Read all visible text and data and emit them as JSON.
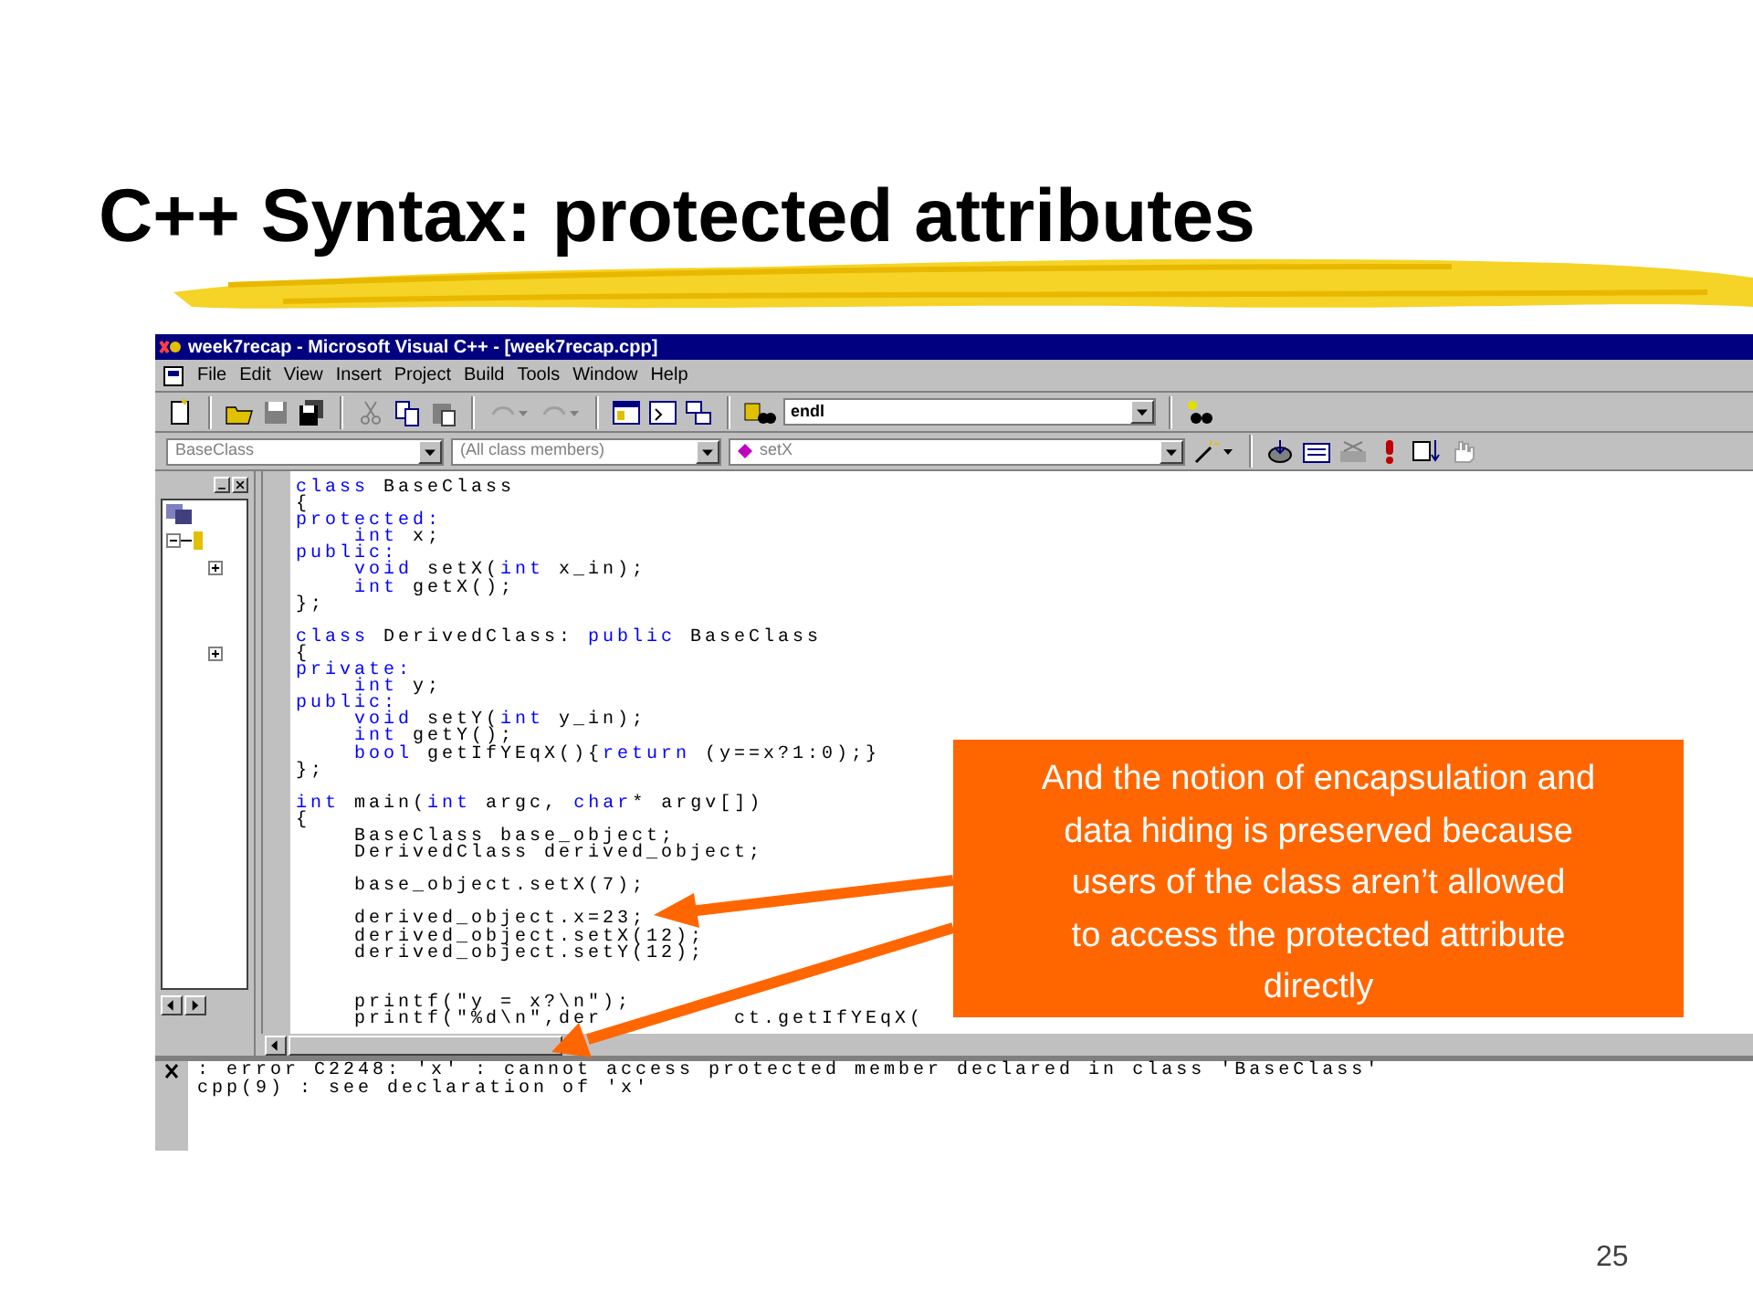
{
  "slide": {
    "title": "C++ Syntax: protected attributes",
    "page_number": "25"
  },
  "window": {
    "title": "week7recap - Microsoft Visual C++ - [week7recap.cpp]"
  },
  "menu": [
    "File",
    "Edit",
    "View",
    "Insert",
    "Project",
    "Build",
    "Tools",
    "Window",
    "Help"
  ],
  "toolbar": {
    "find_value": "endl"
  },
  "wizard_bar": {
    "class": "BaseClass",
    "filter": "(All class members)",
    "member": "setX"
  },
  "editor": {
    "lines": [
      {
        "kind": "code",
        "segments": [
          {
            "kind": "keyword",
            "text": "class"
          },
          {
            "kind": "plain",
            "text": " BaseClass"
          }
        ]
      },
      {
        "kind": "code",
        "segments": [
          {
            "kind": "plain",
            "text": "{"
          }
        ]
      },
      {
        "kind": "code",
        "segments": [
          {
            "kind": "keyword",
            "text": "protected:"
          }
        ]
      },
      {
        "kind": "code",
        "segments": [
          {
            "kind": "keyword",
            "text": "    int"
          },
          {
            "kind": "plain",
            "text": " x;"
          }
        ]
      },
      {
        "kind": "code",
        "segments": [
          {
            "kind": "keyword",
            "text": "public:"
          }
        ]
      },
      {
        "kind": "code",
        "segments": [
          {
            "kind": "keyword",
            "text": "    void"
          },
          {
            "kind": "plain",
            "text": " setX("
          },
          {
            "kind": "keyword",
            "text": "int"
          },
          {
            "kind": "plain",
            "text": " x_in);"
          }
        ]
      },
      {
        "kind": "code",
        "segments": [
          {
            "kind": "keyword",
            "text": "    int"
          },
          {
            "kind": "plain",
            "text": " getX();"
          }
        ]
      },
      {
        "kind": "code",
        "segments": [
          {
            "kind": "plain",
            "text": "};"
          }
        ]
      },
      {
        "kind": "blank"
      },
      {
        "kind": "code",
        "segments": [
          {
            "kind": "keyword",
            "text": "class"
          },
          {
            "kind": "plain",
            "text": " DerivedClass: "
          },
          {
            "kind": "keyword",
            "text": "public"
          },
          {
            "kind": "plain",
            "text": " BaseClass"
          }
        ]
      },
      {
        "kind": "code",
        "segments": [
          {
            "kind": "plain",
            "text": "{"
          }
        ]
      },
      {
        "kind": "code",
        "segments": [
          {
            "kind": "keyword",
            "text": "private:"
          }
        ]
      },
      {
        "kind": "code",
        "segments": [
          {
            "kind": "keyword",
            "text": "    int"
          },
          {
            "kind": "plain",
            "text": " y;"
          }
        ]
      },
      {
        "kind": "code",
        "segments": [
          {
            "kind": "keyword",
            "text": "public:"
          }
        ]
      },
      {
        "kind": "code",
        "segments": [
          {
            "kind": "keyword",
            "text": "    void"
          },
          {
            "kind": "plain",
            "text": " setY("
          },
          {
            "kind": "keyword",
            "text": "int"
          },
          {
            "kind": "plain",
            "text": " y_in);"
          }
        ]
      },
      {
        "kind": "code",
        "segments": [
          {
            "kind": "keyword",
            "text": "    int"
          },
          {
            "kind": "plain",
            "text": " getY();"
          }
        ]
      },
      {
        "kind": "code",
        "segments": [
          {
            "kind": "keyword",
            "text": "    bool"
          },
          {
            "kind": "plain",
            "text": " getIfYEqX(){"
          },
          {
            "kind": "keyword",
            "text": "return"
          },
          {
            "kind": "plain",
            "text": " (y==x?1:0);}"
          }
        ]
      },
      {
        "kind": "code",
        "segments": [
          {
            "kind": "plain",
            "text": "};"
          }
        ]
      },
      {
        "kind": "blank"
      },
      {
        "kind": "code",
        "segments": [
          {
            "kind": "keyword",
            "text": "int"
          },
          {
            "kind": "plain",
            "text": " main("
          },
          {
            "kind": "keyword",
            "text": "int"
          },
          {
            "kind": "plain",
            "text": " argc, "
          },
          {
            "kind": "keyword",
            "text": "char"
          },
          {
            "kind": "plain",
            "text": "* argv[])"
          }
        ]
      },
      {
        "kind": "code",
        "segments": [
          {
            "kind": "plain",
            "text": "{"
          }
        ]
      },
      {
        "kind": "code",
        "segments": [
          {
            "kind": "plain",
            "text": "    BaseClass base_object;"
          }
        ]
      },
      {
        "kind": "code",
        "segments": [
          {
            "kind": "plain",
            "text": "    DerivedClass derived_object;"
          }
        ]
      },
      {
        "kind": "blank"
      },
      {
        "kind": "code",
        "segments": [
          {
            "kind": "plain",
            "text": "    base_object.setX(7);"
          }
        ]
      },
      {
        "kind": "blank"
      },
      {
        "kind": "code",
        "segments": [
          {
            "kind": "plain",
            "text": "    derived_object.x=23;"
          }
        ]
      },
      {
        "kind": "code",
        "segments": [
          {
            "kind": "plain",
            "text": "    derived_object.setX(12);"
          }
        ]
      },
      {
        "kind": "code",
        "segments": [
          {
            "kind": "plain",
            "text": "    derived_object.setY(12);"
          }
        ]
      },
      {
        "kind": "blank"
      },
      {
        "kind": "blank"
      },
      {
        "kind": "code",
        "segments": [
          {
            "kind": "plain",
            "text": "    printf(\"y = x?\\n\");"
          }
        ]
      },
      {
        "kind": "broken",
        "fragments": [
          "    printf(\"%d\\n\",der",
          "ct.getIfYEqX("
        ]
      }
    ]
  },
  "output": {
    "lines": [
      ": error C2248: 'x' : cannot access protected member declared in class 'BaseClass'",
      "cpp(9) : see declaration of 'x'"
    ]
  },
  "callout": {
    "lines": [
      "And the notion of encapsulation and",
      "data hiding is preserved because",
      "users of the class aren’t allowed",
      "to access the protected attribute",
      "directly"
    ]
  }
}
